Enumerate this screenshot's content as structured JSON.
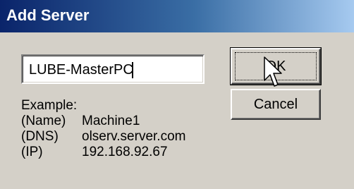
{
  "window": {
    "title": "Add Server"
  },
  "server_input": {
    "value": "LUBE-MasterPC"
  },
  "buttons": {
    "ok_label": "OK",
    "cancel_label": "Cancel"
  },
  "example": {
    "heading": "Example:",
    "rows": [
      {
        "tag": "(Name)",
        "value": "Machine1"
      },
      {
        "tag": "(DNS)",
        "value": "olserv.server.com"
      },
      {
        "tag": "(IP)",
        "value": "192.168.92.67"
      }
    ]
  },
  "colors": {
    "titlebar_start": "#0a246a",
    "titlebar_end": "#a6caf0",
    "dialog_face": "#d4d0c8"
  },
  "icons": {
    "pointer": "mouse-pointer-icon"
  }
}
